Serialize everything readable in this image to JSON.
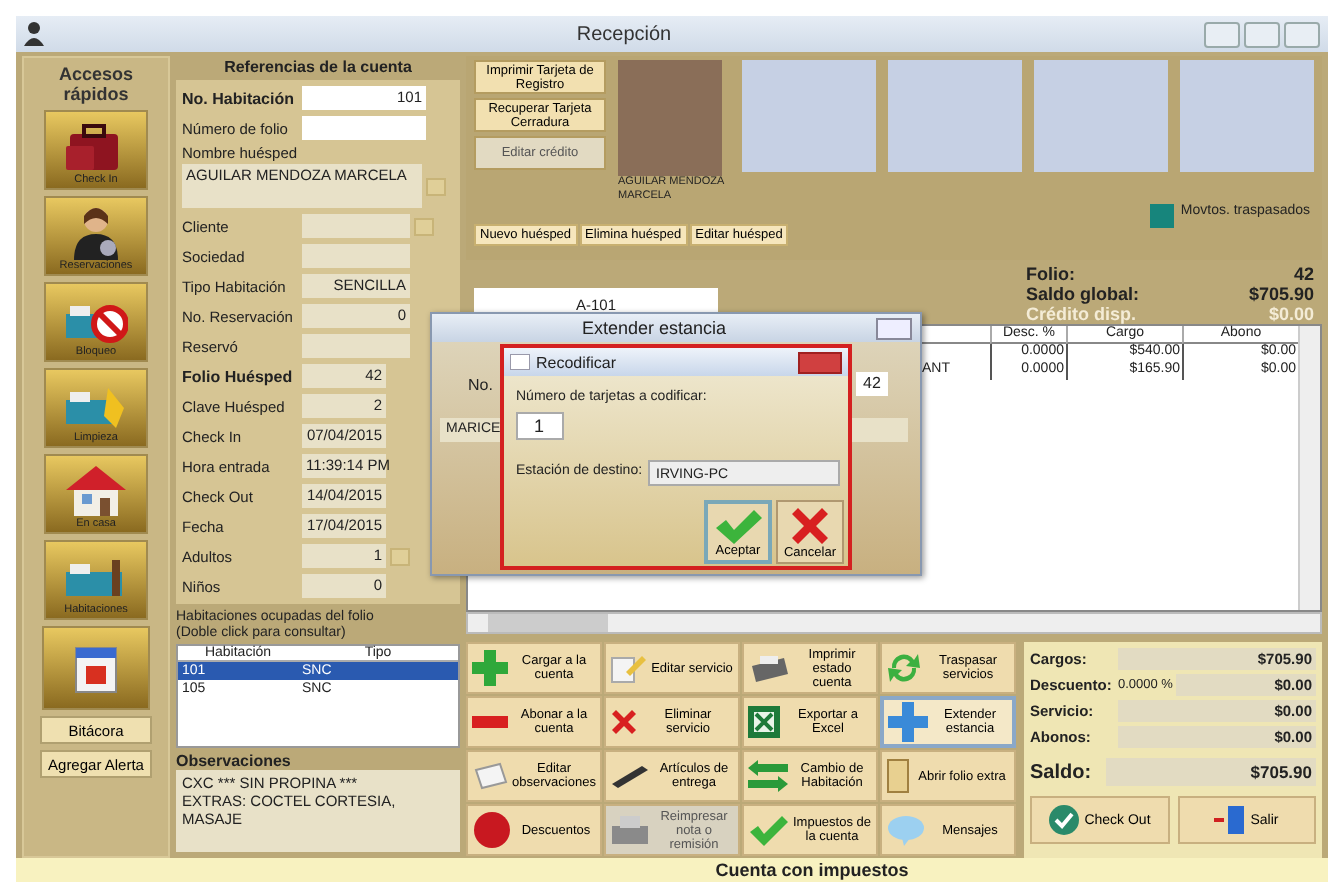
{
  "window": {
    "title": "Recepción"
  },
  "quick_access": {
    "title": "Accesos rápidos",
    "items": [
      "Check In",
      "Reservaciones",
      "Bloqueo",
      "Limpieza",
      "En casa",
      "Habitaciones"
    ],
    "buttons": [
      "Bitácora",
      "Agregar Alerta"
    ]
  },
  "account": {
    "title": "Referencias de la cuenta",
    "fields": [
      {
        "label": "No. Habitación",
        "value": "101",
        "kind": "input",
        "bold": true,
        "lookup": false
      },
      {
        "label": "Número de folio",
        "kind": "input",
        "bold": false,
        "lookup": false
      },
      {
        "label": "Nombre huésped",
        "value": "AGUILAR MENDOZA MARCELA",
        "kind": "memo",
        "bold": false,
        "lookup": true
      },
      {
        "label": "Cliente",
        "kind": "readonly",
        "bold": false,
        "lookup": true
      },
      {
        "label": "Sociedad",
        "kind": "readonly",
        "bold": false,
        "lookup": false
      },
      {
        "label": "Tipo Habitación",
        "value": "SENCILLA",
        "kind": "readonly",
        "bold": false,
        "lookup": false
      },
      {
        "label": "No. Reservación",
        "value": "0",
        "kind": "readonly",
        "bold": false,
        "lookup": false
      },
      {
        "label": "Reservó",
        "kind": "readonly",
        "bold": false,
        "lookup": false
      },
      {
        "label": "Folio Huésped",
        "value": "42",
        "kind": "short",
        "bold": true,
        "lookup": false
      },
      {
        "label": "Clave Huésped",
        "value": "2",
        "kind": "short",
        "bold": false,
        "lookup": false
      },
      {
        "label": "Check In",
        "value": "07/04/2015",
        "kind": "short",
        "bold": false,
        "lookup": false
      },
      {
        "label": "Hora entrada",
        "value": "11:39:14 PM",
        "kind": "short",
        "bold": false,
        "lookup": false
      },
      {
        "label": "Check Out",
        "value": "14/04/2015",
        "kind": "short",
        "bold": false,
        "lookup": false
      },
      {
        "label": "Fecha",
        "value": "17/04/2015",
        "kind": "short",
        "bold": false,
        "lookup": false
      },
      {
        "label": "Adultos",
        "value": "1",
        "kind": "short",
        "bold": false,
        "lookup": true
      },
      {
        "label": "Niños",
        "value": "0",
        "kind": "short",
        "bold": false,
        "lookup": false
      }
    ]
  },
  "rooms": {
    "caption": [
      "Habitaciones ocupadas del folio",
      "(Doble click para consultar)"
    ],
    "columns": [
      "Habitación",
      "Tipo"
    ],
    "rows": [
      {
        "cells": [
          "101",
          "SNC"
        ],
        "selected": true
      },
      {
        "cells": [
          "105",
          "SNC"
        ],
        "selected": false
      }
    ]
  },
  "observations": {
    "title": "Observaciones",
    "text": "CXC *** SIN PROPINA ***\nEXTRAS: COCTEL CORTESIA, MASAJE"
  },
  "guest_panel": {
    "buttons": [
      {
        "label": "Imprimir Tarjeta de Registro",
        "disabled": false
      },
      {
        "label": "Recuperar Tarjeta Cerradura",
        "disabled": false
      },
      {
        "label": "Editar crédito",
        "disabled": true
      }
    ],
    "photo_caption": "AGUILAR MENDOZA MARCELA",
    "guest_buttons": [
      "Nuevo huésped",
      "Elimina huésped",
      "Editar huésped"
    ],
    "legend": {
      "label": "Movtos. traspasados",
      "color": "#17857c"
    }
  },
  "room_code": "A-101",
  "folio_summary": [
    {
      "label": "Folio:",
      "value": "42",
      "disabled": false
    },
    {
      "label": "Saldo global:",
      "value": "$705.90",
      "disabled": false
    },
    {
      "label": "Crédito disp.",
      "value": "$0.00",
      "disabled": true
    }
  ],
  "charges_table": {
    "columns": [
      "Desc. %",
      "Cargo",
      "Abono"
    ],
    "rows": [
      {
        "discount": "0.0000",
        "charge": "$540.00",
        "payment": "$0.00"
      },
      {
        "description": "ANT",
        "discount": "0.0000",
        "charge": "$165.90",
        "payment": "$0.00"
      }
    ]
  },
  "actions": [
    {
      "label": "Cargar a la cuenta",
      "disabled": false,
      "selected": false
    },
    {
      "label": "Editar servicio",
      "disabled": false,
      "selected": false
    },
    {
      "label": "Imprimir estado cuenta",
      "disabled": false,
      "selected": false
    },
    {
      "label": "Traspasar servicios",
      "disabled": false,
      "selected": false
    },
    {
      "label": "Abonar a la cuenta",
      "disabled": false,
      "selected": false
    },
    {
      "label": "Eliminar servicio",
      "disabled": false,
      "selected": false
    },
    {
      "label": "Exportar a Excel",
      "disabled": false,
      "selected": false
    },
    {
      "label": "Extender estancia",
      "disabled": false,
      "selected": true
    },
    {
      "label": "Editar observaciones",
      "disabled": false,
      "selected": false
    },
    {
      "label": "Artículos de entrega",
      "disabled": false,
      "selected": false
    },
    {
      "label": "Cambio de Habitación",
      "disabled": false,
      "selected": false
    },
    {
      "label": "Abrir folio extra",
      "disabled": false,
      "selected": false
    },
    {
      "label": "Descuentos",
      "disabled": false,
      "selected": false
    },
    {
      "label": "Reimpresar nota o remisión",
      "disabled": true,
      "selected": false
    },
    {
      "label": "Impuestos de la cuenta",
      "disabled": false,
      "selected": false
    },
    {
      "label": "Mensajes",
      "disabled": false,
      "selected": false
    }
  ],
  "totals": [
    {
      "label": "Cargos:",
      "value": "$705.90"
    },
    {
      "label": "Descuento:",
      "rate": "0.0000 %",
      "value": "$0.00"
    },
    {
      "label": "Servicio:",
      "value": "$0.00"
    },
    {
      "label": "Abonos:",
      "value": "$0.00"
    }
  ],
  "balance": {
    "label": "Saldo:",
    "value": "$705.90"
  },
  "exit_buttons": [
    "Check Out",
    "Salir"
  ],
  "footer": "Cuenta con impuestos",
  "extend_dialog": {
    "title": "Extender estancia",
    "label": "No.",
    "name_value": "MARICE",
    "folio_value": "42"
  },
  "recode_dialog": {
    "title": "Recodificar",
    "count_label": "Número de tarjetas a codificar:",
    "count": "1",
    "station_label": "Estación de destino:",
    "station": "IRVING-PC",
    "buttons": [
      {
        "label": "Aceptar",
        "focused": true
      },
      {
        "label": "Cancelar",
        "focused": false
      }
    ]
  }
}
